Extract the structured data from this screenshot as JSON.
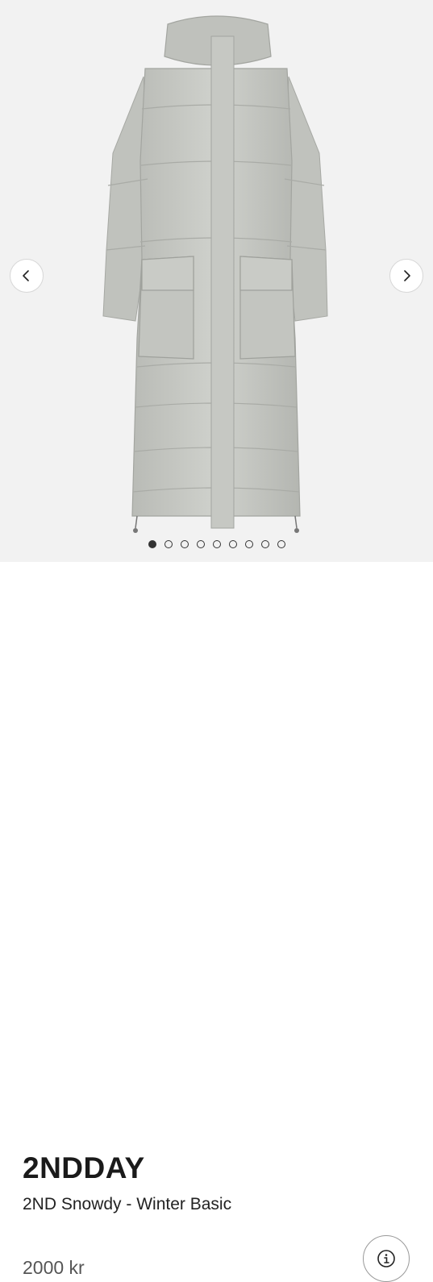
{
  "gallery": {
    "image_alt": "Long grey quilted puffer coat",
    "prev_icon": "chevron-left-icon",
    "next_icon": "chevron-right-icon",
    "image_count": 9,
    "active_index": 0
  },
  "product": {
    "brand": "2NDDAY",
    "name": "2ND Snowdy - Winter Basic",
    "price": "2000 kr",
    "info_icon": "info-icon"
  }
}
